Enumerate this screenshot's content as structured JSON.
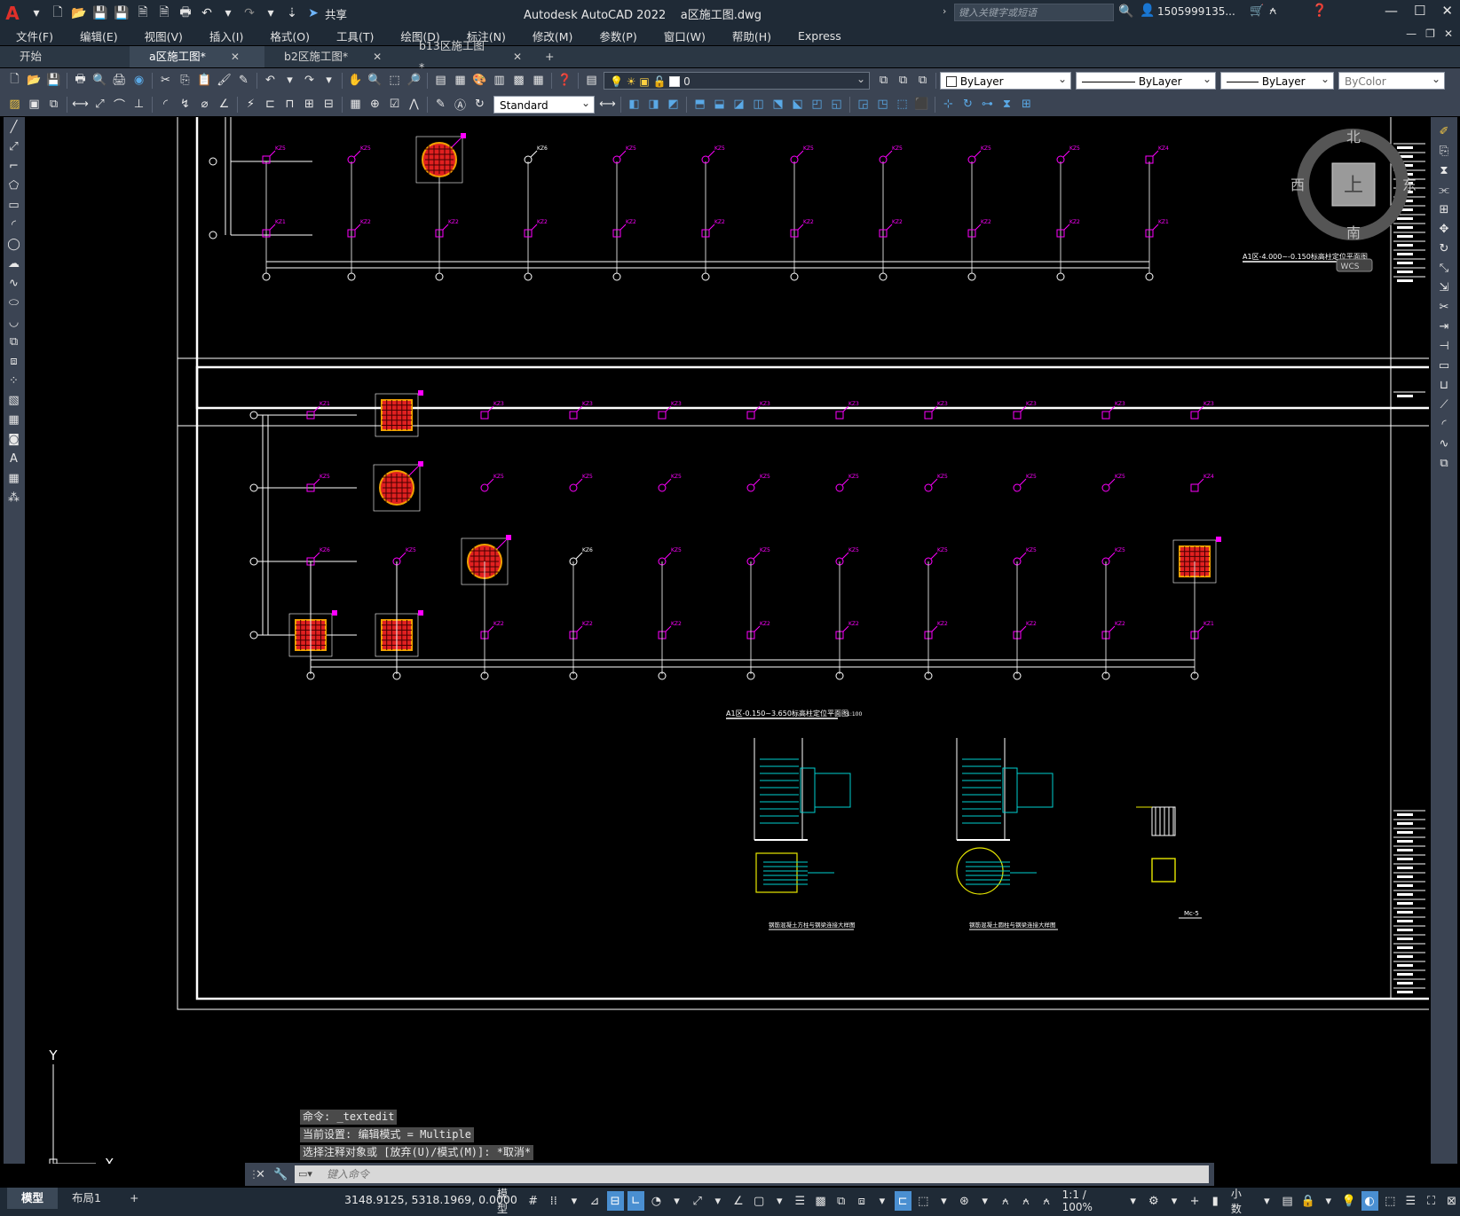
{
  "title_bar": {
    "app_title": "Autodesk AutoCAD 2022    a区施工图.dwg",
    "share_label": "共享",
    "search_placeholder": "键入关键字或短语",
    "user_name": "1505999135..."
  },
  "menu": [
    "文件(F)",
    "编辑(E)",
    "视图(V)",
    "插入(I)",
    "格式(O)",
    "工具(T)",
    "绘图(D)",
    "标注(N)",
    "修改(M)",
    "参数(P)",
    "窗口(W)",
    "帮助(H)",
    "Express"
  ],
  "tabs": [
    {
      "label": "开始",
      "closable": false,
      "active": false
    },
    {
      "label": "a区施工图*",
      "closable": true,
      "active": true
    },
    {
      "label": "b2区施工图*",
      "closable": true,
      "active": false
    },
    {
      "label": "b13区施工图*",
      "closable": true,
      "active": false
    }
  ],
  "toolbar": {
    "layer_value": "0",
    "color_value": "ByLayer",
    "linetype_value": "ByLayer",
    "lineweight_value": "ByLayer",
    "plotstyle_value": "ByColor",
    "textstyle_value": "Standard"
  },
  "viewcube": {
    "north": "北",
    "south": "南",
    "west": "西",
    "east": "东",
    "face": "上",
    "wcs": "WCS"
  },
  "drawing": {
    "labels": {
      "plan_top": "A1区-4.000~-0.150标高柱定位平面图",
      "plan_bottom": "A1区-0.150~3.650标高柱定位平面图",
      "scale": "1:100",
      "detail_left": "钢筋混凝土方柱与钢梁连接大样图",
      "detail_mid": "钢筋混凝土圆柱与钢梁连接大样图",
      "detail_right": "Mc-5"
    },
    "column_tags": [
      "KZ1",
      "KZ2",
      "KZ3",
      "KZ4",
      "KZ5",
      "KZ6"
    ]
  },
  "ucs": {
    "y": "Y",
    "x": "X"
  },
  "command_line": {
    "history": [
      "命令: _textedit",
      "当前设置: 编辑模式 = Multiple",
      "选择注释对象或 [放弃(U)/模式(M)]: *取消*"
    ],
    "placeholder": "键入命令"
  },
  "status_bar": {
    "layout_tabs": [
      "模型",
      "布局1"
    ],
    "coordinates": "3148.9125, 5318.1969, 0.0000",
    "model_label": "模型",
    "scale_label": "1:1 / 100%",
    "units_label": "小数"
  },
  "colors": {
    "accent": "#4a8fd1",
    "magenta": "#ff00ff",
    "cyan": "#00d0d0",
    "column_fill": "#e02020",
    "column_edge": "#f0a000"
  }
}
